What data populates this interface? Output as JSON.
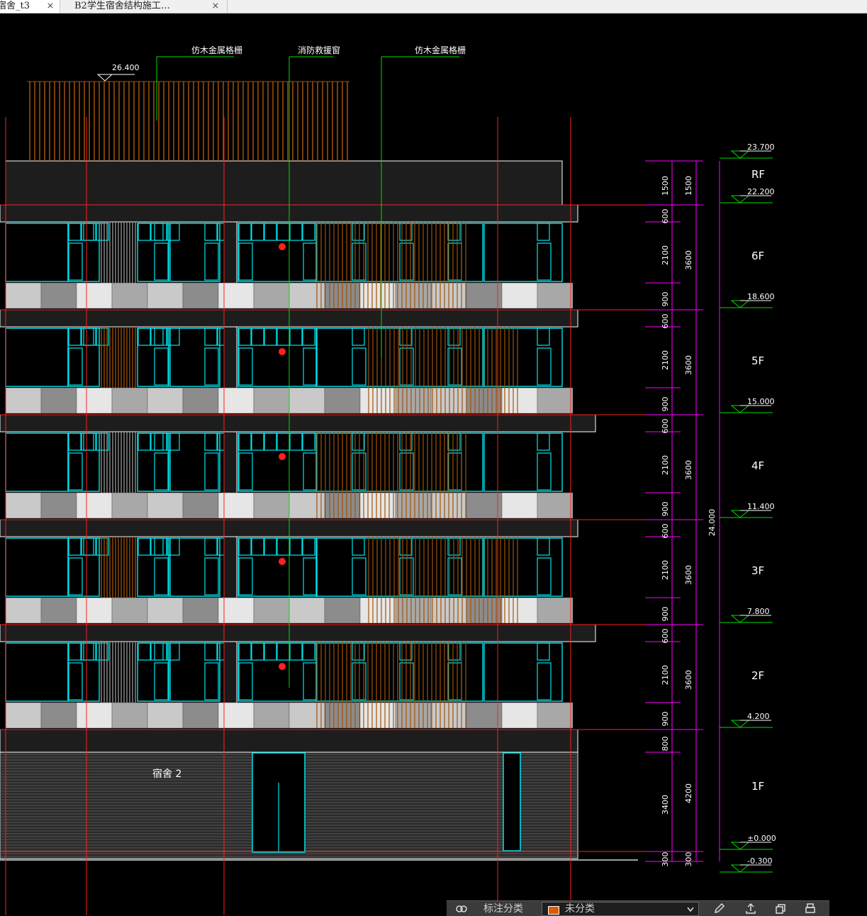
{
  "tabs": [
    {
      "label": "宿舍_t3",
      "active": true
    },
    {
      "label": "B2学生宿舍结构施工…",
      "active": false
    }
  ],
  "close_glyph": "×",
  "drawing": {
    "labels": {
      "left_grille": "仿木金属格栅",
      "fire_window": "消防救援窗",
      "right_grille": "仿木金属格栅",
      "top_elev": "26.400",
      "ground_room": "宿舍  2"
    },
    "levels": [
      {
        "floor": "RF",
        "elevation": "23.700"
      },
      {
        "floor": "",
        "elevation": "22.200"
      },
      {
        "floor": "6F",
        "elevation": "18.600"
      },
      {
        "floor": "5F",
        "elevation": "15.000"
      },
      {
        "floor": "4F",
        "elevation": "11.400"
      },
      {
        "floor": "3F",
        "elevation": "7.800"
      },
      {
        "floor": "2F",
        "elevation": "4.200"
      },
      {
        "floor": "1F",
        "elevation": "±0.000"
      },
      {
        "floor": "",
        "elevation": "-0.300"
      }
    ],
    "dims_inner": [
      "1500",
      "600",
      "2100",
      "900",
      "600",
      "2100",
      "900",
      "600",
      "2100",
      "900",
      "600",
      "2100",
      "900",
      "600",
      "2100",
      "900",
      "800",
      "3400",
      "300"
    ],
    "dims_mid": [
      "1500",
      "3600",
      "3600",
      "3600",
      "3600",
      "3600",
      "4200",
      "300"
    ],
    "total_height": "24.000"
  },
  "statusbar": {
    "annotation_scale_label": "标注分类",
    "layer_value": "未分类",
    "swatch_color": "#e05a00"
  },
  "colors": {
    "background": "#000000",
    "grid_red": "#ff2020",
    "window_cyan": "#00e5ee",
    "dim_magenta": "#ff00ff",
    "leader_green": "#00dd00",
    "grille_brown": "#a0520a",
    "white": "#ffffff"
  }
}
